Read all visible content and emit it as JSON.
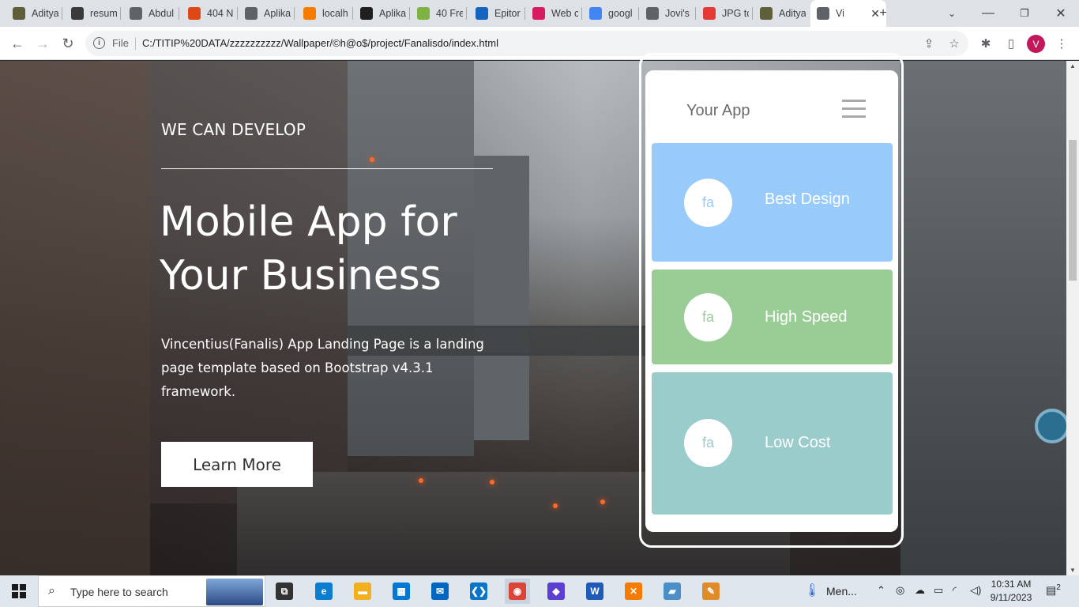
{
  "browser": {
    "tabs": [
      {
        "label": "Aditya",
        "favicon": "avatar-icon",
        "color": "#5f5f3a"
      },
      {
        "label": "resum",
        "favicon": "person-icon",
        "color": "#3a3a3a"
      },
      {
        "label": "Abdul",
        "favicon": "globe-icon",
        "color": "#5f6368"
      },
      {
        "label": "404 N",
        "favicon": "codeigniter-icon",
        "color": "#dd4814"
      },
      {
        "label": "Aplika",
        "favicon": "globe-icon",
        "color": "#5f6368"
      },
      {
        "label": "localh",
        "favicon": "xampp-icon",
        "color": "#f57c00"
      },
      {
        "label": "Aplika",
        "favicon": "r-icon",
        "color": "#1f1f1f"
      },
      {
        "label": "40 Fre",
        "favicon": "chart-icon",
        "color": "#7cb342"
      },
      {
        "label": "Epitor",
        "favicon": "bolt-icon",
        "color": "#1565c0"
      },
      {
        "label": "Web c",
        "favicon": "e-icon",
        "color": "#d81b60"
      },
      {
        "label": "googl",
        "favicon": "google-icon",
        "color": "#4285f4"
      },
      {
        "label": "Jovi's",
        "favicon": "globe-icon",
        "color": "#5f6368"
      },
      {
        "label": "JPG tc",
        "favicon": "jpg-icon",
        "color": "#e53935"
      },
      {
        "label": "Aditya",
        "favicon": "avatar-icon",
        "color": "#5f5f3a"
      },
      {
        "label": "Vi",
        "favicon": "globe-icon",
        "color": "#5f6368",
        "active": true
      }
    ],
    "new_tab_symbol": "+",
    "tab_close_symbol": "✕",
    "scheme_label": "File",
    "url": "C:/TITIP%20DATA/zzzzzzzzzz/Wallpaper/©h@o$/project/Fanalisdo/index.html",
    "profile_initial": "V"
  },
  "page": {
    "hero": {
      "kicker": "WE CAN DEVELOP",
      "title": "Mobile App for Your Business",
      "description": "Vincentius(Fanalis) App Landing Page is a landing page template based on Bootstrap v4.3.1 framework.",
      "button": "Learn More"
    },
    "phone": {
      "app_name": "Your App",
      "features": [
        {
          "label": "Best Design",
          "icon": "fa",
          "color": "#99cbfa",
          "icon_color": "#99cbfa"
        },
        {
          "label": "High Speed",
          "icon": "fa",
          "color": "#9acc96",
          "icon_color": "#9acc96"
        },
        {
          "label": "Low Cost",
          "icon": "fa",
          "color": "#9acccc",
          "icon_color": "#9acccc"
        }
      ]
    }
  },
  "taskbar": {
    "search_placeholder": "Type here to search",
    "apps": [
      {
        "name": "task-view-icon",
        "color": "#333333",
        "glyph": "⧉"
      },
      {
        "name": "edge-icon",
        "color": "#0c7ed1",
        "glyph": "e"
      },
      {
        "name": "file-explorer-icon",
        "color": "#f2b01e",
        "glyph": "▬"
      },
      {
        "name": "store-icon",
        "color": "#0078d4",
        "glyph": "▦"
      },
      {
        "name": "mail-icon",
        "color": "#0067c0",
        "glyph": "✉"
      },
      {
        "name": "vscode-icon",
        "color": "#0a74c8",
        "glyph": "❮❯"
      },
      {
        "name": "chrome-icon",
        "color": "#db4437",
        "glyph": "◉"
      },
      {
        "name": "copilot-icon",
        "color": "#5a3fd1",
        "glyph": "◆"
      },
      {
        "name": "word-icon",
        "color": "#1e5bb8",
        "glyph": "W"
      },
      {
        "name": "xampp-icon",
        "color": "#f57c00",
        "glyph": "✕"
      },
      {
        "name": "notes-icon",
        "color": "#4a8fc7",
        "glyph": "▰"
      },
      {
        "name": "paint-icon",
        "color": "#e08a2a",
        "glyph": "✎"
      }
    ],
    "tray_label": "Men...",
    "time": "10:31 AM",
    "date": "9/11/2023",
    "notification_count": "2"
  }
}
